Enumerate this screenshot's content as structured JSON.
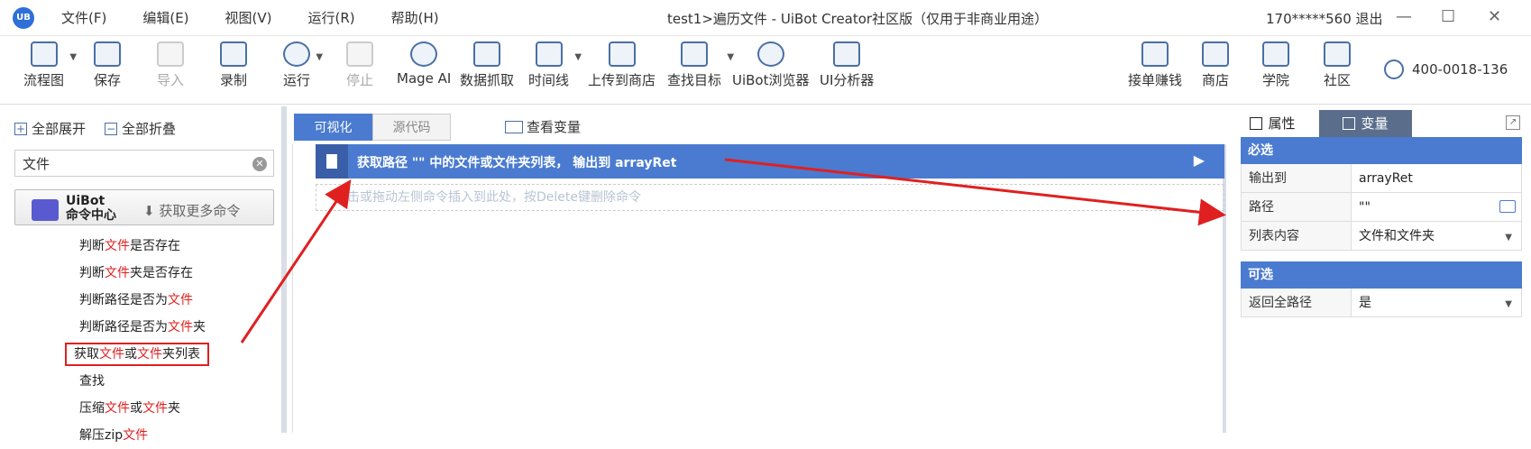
{
  "app": {
    "logo": "UB",
    "menu": [
      "文件(F)",
      "编辑(E)",
      "视图(V)",
      "运行(R)",
      "帮助(H)"
    ],
    "title": "test1>遍历文件 - UiBot Creator社区版（仅用于非商业用途）",
    "user": "170*****560  退出"
  },
  "toolbar": {
    "left": [
      "流程图",
      "保存",
      "导入",
      "录制",
      "运行",
      "停止",
      "Mage AI",
      "数据抓取",
      "时间线",
      "上传到商店",
      "查找目标",
      "UiBot浏览器",
      "UI分析器"
    ],
    "right": [
      "接单赚钱",
      "商店",
      "学院",
      "社区"
    ],
    "phone": "400-0018-136"
  },
  "left_panel": {
    "expand_all": "全部展开",
    "collapse_all": "全部折叠",
    "search_value": "文件",
    "cmd_center_title1": "UiBot",
    "cmd_center_title2": "命令中心",
    "get_more": "获取更多命令",
    "tree": [
      {
        "parts": [
          [
            "判断",
            ""
          ],
          [
            "文件",
            "red"
          ],
          [
            "是否存在",
            ""
          ]
        ]
      },
      {
        "parts": [
          [
            "判断",
            ""
          ],
          [
            "文件",
            "red"
          ],
          [
            "夹是否存在",
            ""
          ]
        ]
      },
      {
        "parts": [
          [
            "判断路径是否为",
            ""
          ],
          [
            "文件",
            "red"
          ]
        ]
      },
      {
        "parts": [
          [
            "判断路径是否为",
            ""
          ],
          [
            "文件",
            "red"
          ],
          [
            "夹",
            ""
          ]
        ]
      },
      {
        "parts": [
          [
            "获取",
            ""
          ],
          [
            "文件",
            "red"
          ],
          [
            "或",
            ""
          ],
          [
            "文件",
            "red"
          ],
          [
            "夹列表",
            ""
          ]
        ],
        "selected": true
      },
      {
        "parts": [
          [
            "查找",
            ""
          ]
        ]
      },
      {
        "parts": [
          [
            "压缩",
            ""
          ],
          [
            "文件",
            "red"
          ],
          [
            "或",
            ""
          ],
          [
            "文件",
            "red"
          ],
          [
            "夹",
            ""
          ]
        ]
      },
      {
        "parts": [
          [
            "解压zip",
            ""
          ],
          [
            "文件",
            "red"
          ]
        ]
      }
    ]
  },
  "center": {
    "tab_visual": "可视化",
    "tab_source": "源代码",
    "view_vars": "查看变量",
    "command_text": "获取路径 \"\" 中的文件或文件夹列表， 输出到 arrayRet",
    "drop_hint": "双击或拖动左侧命令插入到此处，按Delete键删除命令"
  },
  "right_panel": {
    "tab_props": "属性",
    "tab_vars": "变量",
    "required_title": "必选",
    "required": [
      {
        "key": "输出到",
        "value": "arrayRet"
      },
      {
        "key": "路径",
        "value": "\"\""
      },
      {
        "key": "列表内容",
        "value": "文件和文件夹"
      }
    ],
    "optional_title": "可选",
    "optional": [
      {
        "key": "返回全路径",
        "value": "是"
      }
    ]
  }
}
